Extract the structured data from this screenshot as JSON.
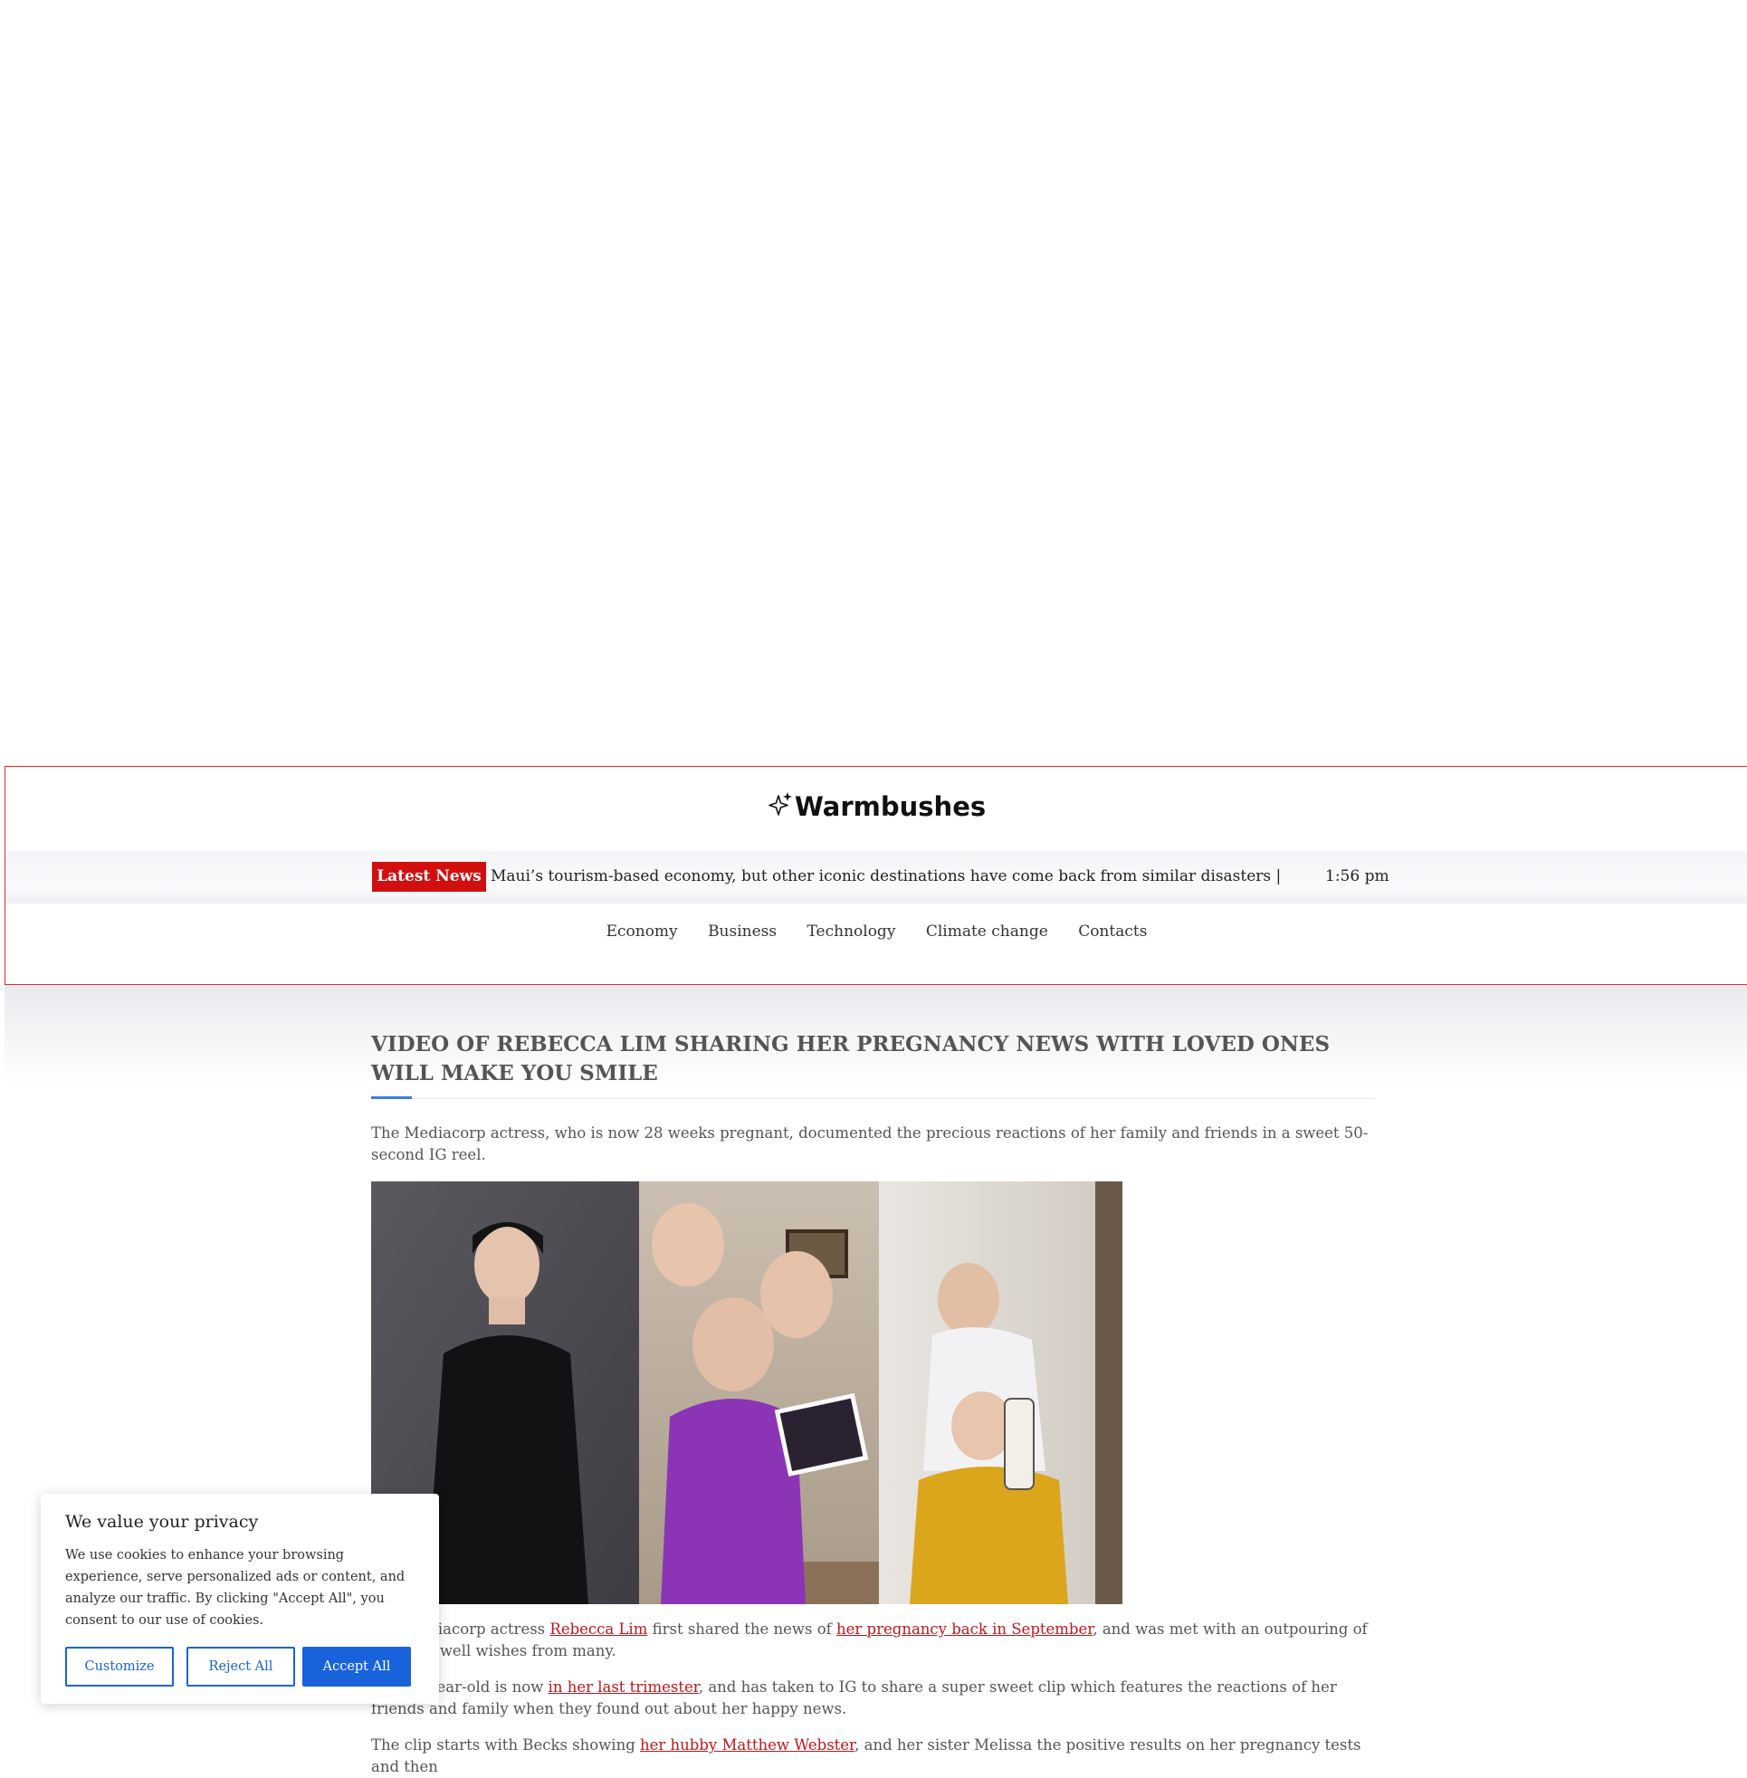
{
  "site": {
    "logo_text": "Warmbushes"
  },
  "ticker": {
    "label": "Latest News",
    "text": "Maui’s tourism-based economy, but other iconic destinations have come back from similar disasters  |  Extra logi",
    "time": "1:56 pm"
  },
  "nav": {
    "items": [
      "Economy",
      "Business",
      "Technology",
      "Climate change",
      "Contacts"
    ]
  },
  "article": {
    "title": "Video Of Rebecca Lim Sharing Her Pregnancy News With Loved Ones Will Make You Smile",
    "lead": "The Mediacorp actress, who is now 28 weeks pregnant, documented the precious reactions of her family and friends in a sweet 50-second IG reel.",
    "p1_a": "The Mediacorp actress ",
    "p1_link1": "Rebecca Lim",
    "p1_b": " first shared the news of ",
    "p1_link2": "her pregnancy back in September",
    "p1_c": ", and was met with an outpouring of love and well wishes from many.",
    "p2_a": "The 36-year-old is now ",
    "p2_link1": "in her last trimester",
    "p2_b": ", and has taken to IG to share a super sweet clip which features the reactions of her friends and family when they found out about her happy news.",
    "p3_a": "The clip starts with Becks showing ",
    "p3_link1": "her hubby Matthew Webster",
    "p3_b": ", and her sister Melissa the positive results on her pregnancy tests and then"
  },
  "cookie": {
    "title": "We value your privacy",
    "body": "We use cookies to enhance your browsing experience, serve personalized ads or content, and analyze our traffic. By clicking \"Accept All\", you consent to our use of cookies.",
    "customize": "Customize",
    "reject": "Reject All",
    "accept": "Accept All"
  },
  "colors": {
    "accent_red": "#d20f0f",
    "link_red": "#c0161b",
    "consent_blue": "#1863dc",
    "title_accent_blue": "#3b7de0"
  }
}
